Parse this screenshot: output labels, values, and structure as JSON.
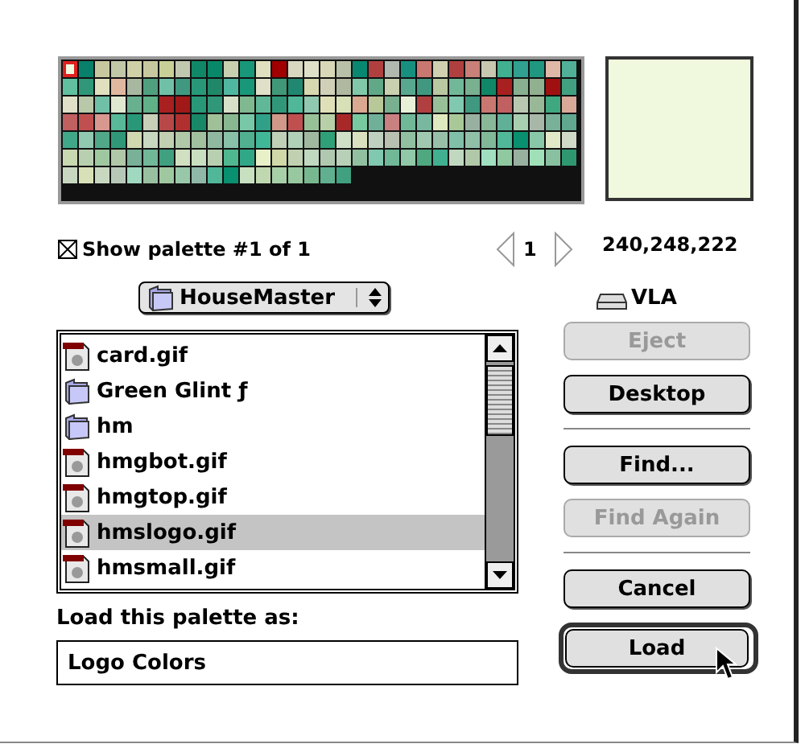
{
  "palette": {
    "swatches": [
      {
        "color": "#f0f8de",
        "selected": true
      },
      {
        "color": "#08806a",
        "selected": false
      },
      {
        "color": "#c8c8a0",
        "selected": false
      },
      {
        "color": "#c0c8a8",
        "selected": false
      },
      {
        "color": "#d0d0a8",
        "selected": false
      },
      {
        "color": "#c8c8a0",
        "selected": false
      },
      {
        "color": "#c8d098",
        "selected": false
      },
      {
        "color": "#c0c8b0",
        "selected": false
      },
      {
        "color": "#108868",
        "selected": false
      },
      {
        "color": "#088868",
        "selected": false
      },
      {
        "color": "#c8d0b0",
        "selected": false
      },
      {
        "color": "#189878",
        "selected": false
      },
      {
        "color": "#e0e0c0",
        "selected": false
      },
      {
        "color": "#a00000",
        "selected": false
      },
      {
        "color": "#d8d8c0",
        "selected": false
      },
      {
        "color": "#e0e0c8",
        "selected": false
      },
      {
        "color": "#d8d8b8",
        "selected": false
      },
      {
        "color": "#b8c0a8",
        "selected": false
      },
      {
        "color": "#088870",
        "selected": false
      },
      {
        "color": "#b04040",
        "selected": false
      },
      {
        "color": "#b0b8b0",
        "selected": false
      },
      {
        "color": "#189080",
        "selected": false
      },
      {
        "color": "#c87870",
        "selected": false
      },
      {
        "color": "#d0d0b0",
        "selected": false
      },
      {
        "color": "#b04040",
        "selected": false
      },
      {
        "color": "#c88078",
        "selected": false
      },
      {
        "color": "#c8c8b0",
        "selected": false
      },
      {
        "color": "#40b090",
        "selected": false
      },
      {
        "color": "#30a090",
        "selected": false
      },
      {
        "color": "#209880",
        "selected": false
      },
      {
        "color": "#e0b8a8",
        "selected": false
      },
      {
        "color": "#50b098",
        "selected": false
      },
      {
        "color": "#60c0a0",
        "selected": false
      },
      {
        "color": "#309878",
        "selected": false
      },
      {
        "color": "#e0e0c0",
        "selected": false
      },
      {
        "color": "#e0b8a0",
        "selected": false
      },
      {
        "color": "#a8b8a0",
        "selected": false
      },
      {
        "color": "#50a080",
        "selected": false
      },
      {
        "color": "#70c0a8",
        "selected": false
      },
      {
        "color": "#409880",
        "selected": false
      },
      {
        "color": "#289878",
        "selected": false
      },
      {
        "color": "#208868",
        "selected": false
      },
      {
        "color": "#50b8a0",
        "selected": false
      },
      {
        "color": "#189878",
        "selected": false
      },
      {
        "color": "#e0e0c8",
        "selected": false
      },
      {
        "color": "#409878",
        "selected": false
      },
      {
        "color": "#208870",
        "selected": false
      },
      {
        "color": "#d8d8b0",
        "selected": false
      },
      {
        "color": "#d0d0b8",
        "selected": false
      },
      {
        "color": "#b0b8a0",
        "selected": false
      },
      {
        "color": "#80c8a8",
        "selected": false
      },
      {
        "color": "#60a888",
        "selected": false
      },
      {
        "color": "#c8d0b0",
        "selected": false
      },
      {
        "color": "#58a890",
        "selected": false
      },
      {
        "color": "#409880",
        "selected": false
      },
      {
        "color": "#b8c8a0",
        "selected": false
      },
      {
        "color": "#70b898",
        "selected": false
      },
      {
        "color": "#78b090",
        "selected": false
      },
      {
        "color": "#108868",
        "selected": false
      },
      {
        "color": "#a82020",
        "selected": false
      },
      {
        "color": "#88b090",
        "selected": false
      },
      {
        "color": "#90b090",
        "selected": false
      },
      {
        "color": "#a01010",
        "selected": false
      },
      {
        "color": "#40a080",
        "selected": false
      },
      {
        "color": "#e0e0c8",
        "selected": false
      },
      {
        "color": "#b8c8a8",
        "selected": false
      },
      {
        "color": "#70c0a8",
        "selected": false
      },
      {
        "color": "#e0e8d0",
        "selected": false
      },
      {
        "color": "#68b090",
        "selected": false
      },
      {
        "color": "#60b088",
        "selected": false
      },
      {
        "color": "#a82020",
        "selected": false
      },
      {
        "color": "#a01818",
        "selected": false
      },
      {
        "color": "#289878",
        "selected": false
      },
      {
        "color": "#309878",
        "selected": false
      },
      {
        "color": "#d8e0c8",
        "selected": false
      },
      {
        "color": "#80b890",
        "selected": false
      },
      {
        "color": "#60b898",
        "selected": false
      },
      {
        "color": "#309878",
        "selected": false
      },
      {
        "color": "#50b898",
        "selected": false
      },
      {
        "color": "#90c8b0",
        "selected": false
      },
      {
        "color": "#e0e0b8",
        "selected": false
      },
      {
        "color": "#d8e0b8",
        "selected": false
      },
      {
        "color": "#d8a890",
        "selected": false
      },
      {
        "color": "#b8c898",
        "selected": false
      },
      {
        "color": "#78b090",
        "selected": false
      },
      {
        "color": "#e8f0d8",
        "selected": false
      },
      {
        "color": "#b04040",
        "selected": false
      },
      {
        "color": "#98c098",
        "selected": false
      },
      {
        "color": "#80c8b0",
        "selected": false
      },
      {
        "color": "#409880",
        "selected": false
      },
      {
        "color": "#c87870",
        "selected": false
      },
      {
        "color": "#c06060",
        "selected": false
      },
      {
        "color": "#b8c8b0",
        "selected": false
      },
      {
        "color": "#98b898",
        "selected": false
      },
      {
        "color": "#40a880",
        "selected": false
      },
      {
        "color": "#d8a898",
        "selected": false
      },
      {
        "color": "#c06060",
        "selected": false
      },
      {
        "color": "#c05050",
        "selected": false
      },
      {
        "color": "#d89890",
        "selected": false
      },
      {
        "color": "#58b898",
        "selected": false
      },
      {
        "color": "#289878",
        "selected": false
      },
      {
        "color": "#c8d0b8",
        "selected": false
      },
      {
        "color": "#b84848",
        "selected": false
      },
      {
        "color": "#b03030",
        "selected": false
      },
      {
        "color": "#188868",
        "selected": false
      },
      {
        "color": "#a0c098",
        "selected": false
      },
      {
        "color": "#88b890",
        "selected": false
      },
      {
        "color": "#78c8a8",
        "selected": false
      },
      {
        "color": "#30a088",
        "selected": false
      },
      {
        "color": "#d09888",
        "selected": false
      },
      {
        "color": "#c05050",
        "selected": false
      },
      {
        "color": "#98c098",
        "selected": false
      },
      {
        "color": "#b8d0a8",
        "selected": false
      },
      {
        "color": "#a82828",
        "selected": false
      },
      {
        "color": "#78c8a0",
        "selected": false
      },
      {
        "color": "#70b098",
        "selected": false
      },
      {
        "color": "#c88080",
        "selected": false
      },
      {
        "color": "#70b898",
        "selected": false
      },
      {
        "color": "#78b8a0",
        "selected": false
      },
      {
        "color": "#e0e8c0",
        "selected": false
      },
      {
        "color": "#a8c898",
        "selected": false
      },
      {
        "color": "#98b0a0",
        "selected": false
      },
      {
        "color": "#88b898",
        "selected": false
      },
      {
        "color": "#60b098",
        "selected": false
      },
      {
        "color": "#a8d0b0",
        "selected": false
      },
      {
        "color": "#a8b8a8",
        "selected": false
      },
      {
        "color": "#78b098",
        "selected": false
      },
      {
        "color": "#60a890",
        "selected": false
      },
      {
        "color": "#40a888",
        "selected": false
      },
      {
        "color": "#90c8b0",
        "selected": false
      },
      {
        "color": "#50a888",
        "selected": false
      },
      {
        "color": "#309878",
        "selected": false
      },
      {
        "color": "#d0d8b0",
        "selected": false
      },
      {
        "color": "#c8d8c0",
        "selected": false
      },
      {
        "color": "#c0d0b0",
        "selected": false
      },
      {
        "color": "#b0c8a8",
        "selected": false
      },
      {
        "color": "#a0c0a0",
        "selected": false
      },
      {
        "color": "#90b8a0",
        "selected": false
      },
      {
        "color": "#88c0a8",
        "selected": false
      },
      {
        "color": "#50b090",
        "selected": false
      },
      {
        "color": "#40b898",
        "selected": false
      },
      {
        "color": "#c0d0b8",
        "selected": false
      },
      {
        "color": "#b0d0b8",
        "selected": false
      },
      {
        "color": "#a0b8a0",
        "selected": false
      },
      {
        "color": "#30a078",
        "selected": false
      },
      {
        "color": "#d0e0c8",
        "selected": false
      },
      {
        "color": "#d8e0c0",
        "selected": false
      },
      {
        "color": "#c0d0c0",
        "selected": false
      },
      {
        "color": "#b8c0b0",
        "selected": false
      },
      {
        "color": "#90c0a0",
        "selected": false
      },
      {
        "color": "#a0c8b0",
        "selected": false
      },
      {
        "color": "#98c0a8",
        "selected": false
      },
      {
        "color": "#80c0a8",
        "selected": false
      },
      {
        "color": "#90c0a8",
        "selected": false
      },
      {
        "color": "#80b898",
        "selected": false
      },
      {
        "color": "#50b898",
        "selected": false
      },
      {
        "color": "#089070",
        "selected": false
      },
      {
        "color": "#88c8a8",
        "selected": false
      },
      {
        "color": "#e0e8c8",
        "selected": false
      },
      {
        "color": "#d0d8c8",
        "selected": false
      },
      {
        "color": "#c8d8b0",
        "selected": false
      },
      {
        "color": "#b8d0b0",
        "selected": false
      },
      {
        "color": "#a0c8a0",
        "selected": false
      },
      {
        "color": "#b0c8a8",
        "selected": false
      },
      {
        "color": "#78b098",
        "selected": false
      },
      {
        "color": "#70b898",
        "selected": false
      },
      {
        "color": "#40a080",
        "selected": false
      },
      {
        "color": "#d0e0c0",
        "selected": false
      },
      {
        "color": "#c8e0c0",
        "selected": false
      },
      {
        "color": "#b8d0b0",
        "selected": false
      },
      {
        "color": "#50b890",
        "selected": false
      },
      {
        "color": "#30a888",
        "selected": false
      },
      {
        "color": "#e8f0c8",
        "selected": false
      },
      {
        "color": "#d0d8a8",
        "selected": false
      },
      {
        "color": "#c0d0b0",
        "selected": false
      },
      {
        "color": "#c0d8c0",
        "selected": false
      },
      {
        "color": "#b0c8b0",
        "selected": false
      },
      {
        "color": "#b8d0b8",
        "selected": false
      },
      {
        "color": "#90c0a0",
        "selected": false
      },
      {
        "color": "#80c8b0",
        "selected": false
      },
      {
        "color": "#70b898",
        "selected": false
      },
      {
        "color": "#90c8a8",
        "selected": false
      },
      {
        "color": "#50a880",
        "selected": false
      },
      {
        "color": "#40b090",
        "selected": false
      },
      {
        "color": "#c0d8c0",
        "selected": false
      },
      {
        "color": "#b0c8a8",
        "selected": false
      },
      {
        "color": "#a0e0c0",
        "selected": false
      },
      {
        "color": "#90c8a0",
        "selected": false
      },
      {
        "color": "#98b0a0",
        "selected": false
      },
      {
        "color": "#a0e0b8",
        "selected": false
      },
      {
        "color": "#88c0a0",
        "selected": false
      },
      {
        "color": "#309870",
        "selected": false
      },
      {
        "color": "#c8d8c0",
        "selected": false
      },
      {
        "color": "#d8e0b8",
        "selected": false
      },
      {
        "color": "#c8d8c0",
        "selected": false
      },
      {
        "color": "#b8c8b8",
        "selected": false
      },
      {
        "color": "#a0d8c0",
        "selected": false
      },
      {
        "color": "#98c0a0",
        "selected": false
      },
      {
        "color": "#a0c8a0",
        "selected": false
      },
      {
        "color": "#98c8a8",
        "selected": false
      },
      {
        "color": "#90b8a8",
        "selected": false
      },
      {
        "color": "#50b898",
        "selected": false
      },
      {
        "color": "#089070",
        "selected": false
      },
      {
        "color": "#c8e0c0",
        "selected": false
      },
      {
        "color": "#c0d8b0",
        "selected": false
      },
      {
        "color": "#a8d0a8",
        "selected": false
      },
      {
        "color": "#98c8a0",
        "selected": false
      },
      {
        "color": "#78b890",
        "selected": false
      },
      {
        "color": "#60b090",
        "selected": false
      },
      {
        "color": "#40a080",
        "selected": false
      }
    ],
    "preview": {
      "color": "#f0f8de"
    },
    "show_palette": {
      "label": "Show palette #1 of 1",
      "checked": true
    },
    "page_number": "1",
    "rgb": "240,248,222"
  },
  "folder_popup": {
    "label": "HouseMaster"
  },
  "volume": {
    "label": "VLA"
  },
  "files": [
    {
      "kind": "document",
      "name": "card.gif",
      "selected": false
    },
    {
      "kind": "folder",
      "name": "Green Glint ƒ",
      "selected": false
    },
    {
      "kind": "folder",
      "name": "hm",
      "selected": false
    },
    {
      "kind": "document",
      "name": "hmgbot.gif",
      "selected": false
    },
    {
      "kind": "document",
      "name": "hmgtop.gif",
      "selected": false
    },
    {
      "kind": "document",
      "name": "hmslogo.gif",
      "selected": true
    },
    {
      "kind": "document",
      "name": "hmsmall.gif",
      "selected": false
    }
  ],
  "name_field": {
    "label": "Load this palette as:",
    "value": "Logo Colors"
  },
  "button_groups": [
    [
      {
        "label": "Eject",
        "disabled": true,
        "default": false
      },
      {
        "label": "Desktop",
        "disabled": false,
        "default": false
      }
    ],
    [
      {
        "label": "Find...",
        "disabled": false,
        "default": false
      },
      {
        "label": "Find Again",
        "disabled": true,
        "default": false
      }
    ],
    [
      {
        "label": "Cancel",
        "disabled": false,
        "default": false
      },
      {
        "label": "Load",
        "disabled": false,
        "default": true
      }
    ]
  ]
}
